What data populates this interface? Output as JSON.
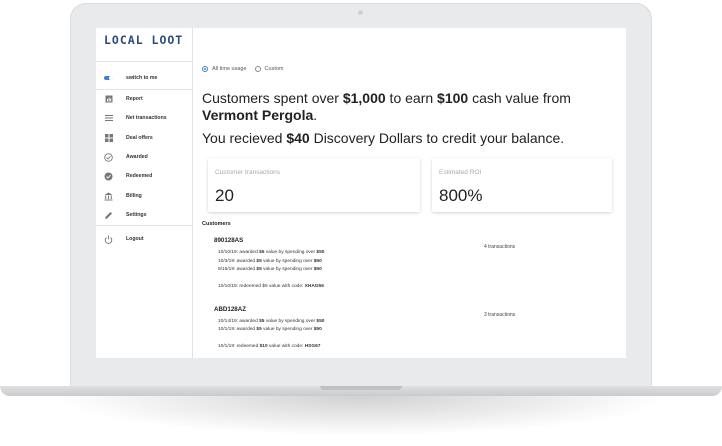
{
  "sidebar": {
    "logo": "LOCAL LOOT",
    "items": [
      {
        "label": "switch to me",
        "icon": "toggle-icon"
      },
      {
        "label": "Report",
        "icon": "report-icon"
      },
      {
        "label": "Net transactions",
        "icon": "list-icon"
      },
      {
        "label": "Deal offers",
        "icon": "grid-icon"
      },
      {
        "label": "Awarded",
        "icon": "check-circle-icon"
      },
      {
        "label": "Redeemed",
        "icon": "check-filled-icon"
      },
      {
        "label": "Billing",
        "icon": "bank-icon"
      },
      {
        "label": "Settings",
        "icon": "pencil-icon"
      },
      {
        "label": "Logout",
        "icon": "power-icon"
      }
    ]
  },
  "filters": {
    "all_time": "All time usage",
    "custom": "Custom"
  },
  "headline": {
    "part1": "Customers spent over ",
    "amount1": "$1,000",
    "part2": " to earn ",
    "amount2": "$100",
    "part3": " cash value from ",
    "merchant": "Vermont Pergola",
    "part4": "."
  },
  "subline": {
    "part1": "You recieved ",
    "amount": "$40",
    "part2": " Discovery Dollars to credit your balance."
  },
  "cards": {
    "transactions_label": "Customer transactions",
    "transactions_value": "20",
    "roi_label": "Estimated ROI",
    "roi_value": "800%"
  },
  "customers": {
    "title": "Customers",
    "list": [
      {
        "id": "890128AS",
        "count": "4 transactions",
        "awards": [
          {
            "date": "10/10/19: awarded ",
            "value": "$5",
            "mid": " value by spending over ",
            "spend": "$50"
          },
          {
            "date": "10/3/19: awarded ",
            "value": "$5",
            "mid": " value by spending over ",
            "spend": "$50"
          },
          {
            "date": "9/15/19: awarded ",
            "value": "$5",
            "mid": " value by spending over ",
            "spend": "$50"
          }
        ],
        "redeem": {
          "text": "10/10/19: redeemed $5 value with code: ",
          "code": "XHAG56"
        }
      },
      {
        "id": "ABD128AZ",
        "count": "3 transactions",
        "awards": [
          {
            "date": "10/14/19: awarded ",
            "value": "$5",
            "mid": " value by spending over ",
            "spend": "$50"
          },
          {
            "date": "10/1/19: awarded ",
            "value": "$5",
            "mid": " value by spending over ",
            "spend": "$50"
          }
        ],
        "redeem": {
          "text": "10/1/19: redeemed ",
          "value": "$10",
          "text2": " value with code: ",
          "code": "HSG67"
        }
      }
    ]
  },
  "colors": {
    "accent": "#3f7fd8",
    "logo": "#2c4b78"
  }
}
